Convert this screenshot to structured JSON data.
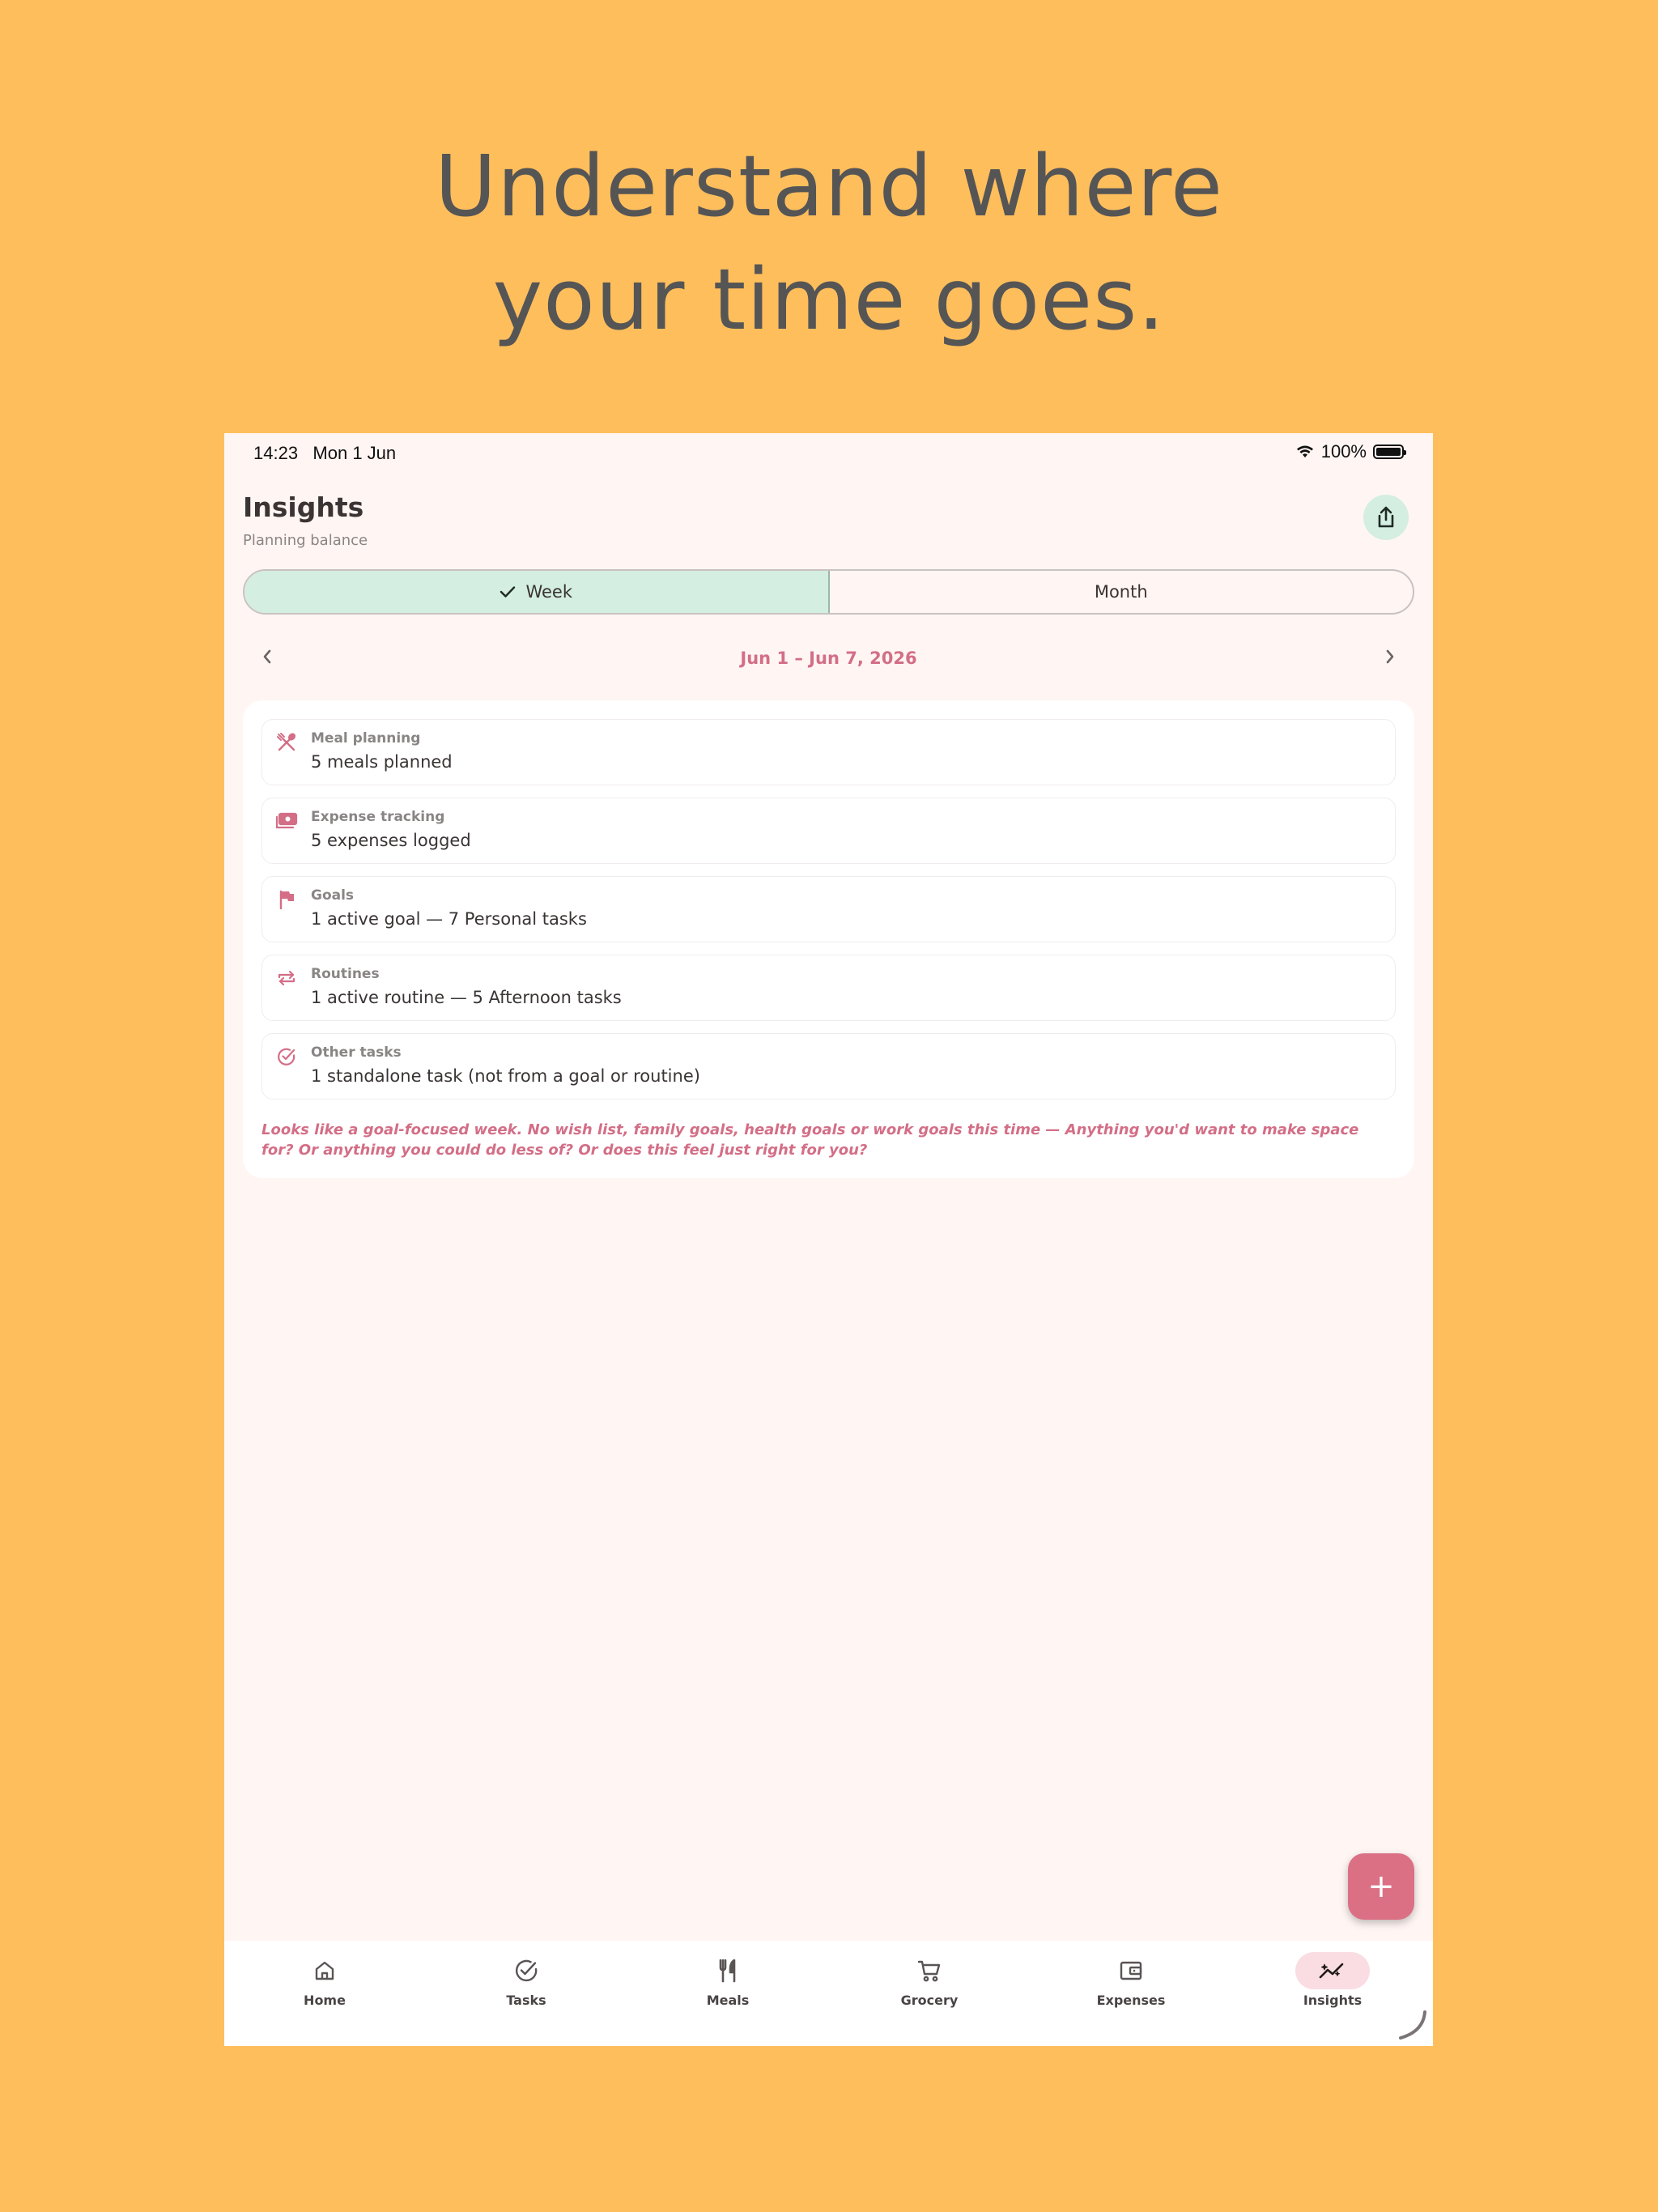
{
  "headline": {
    "line1": "Understand where",
    "line2": "your time goes."
  },
  "status_bar": {
    "time": "14:23",
    "date": "Mon 1 Jun",
    "battery": "100%",
    "battery_level": 1.0
  },
  "header": {
    "title": "Insights",
    "subtitle": "Planning balance",
    "share_icon": "share-icon"
  },
  "segmented": {
    "week_label": "Week",
    "month_label": "Month",
    "selected": "Week"
  },
  "date_range": {
    "label": "Jun 1 – Jun 7, 2026"
  },
  "items": [
    {
      "label": "Meal planning",
      "value": "5 meals planned",
      "icon": "utensils-icon"
    },
    {
      "label": "Expense tracking",
      "value": "5 expenses logged",
      "icon": "money-icon"
    },
    {
      "label": "Goals",
      "value": "1 active goal — 7 Personal tasks",
      "icon": "flag-icon"
    },
    {
      "label": "Routines",
      "value": "1 active routine — 5 Afternoon tasks",
      "icon": "repeat-icon"
    },
    {
      "label": "Other tasks",
      "value": "1 standalone task (not from a goal or routine)",
      "icon": "check-circle-icon"
    }
  ],
  "note": "Looks like a goal-focused week. No wish list, family goals, health goals or work goals this time — Anything you'd want to make space for? Or anything you could do less of? Or does this feel just right for you?",
  "fab": {
    "label": "+"
  },
  "nav": [
    {
      "label": "Home",
      "icon": "home-icon"
    },
    {
      "label": "Tasks",
      "icon": "check-circle-icon"
    },
    {
      "label": "Meals",
      "icon": "fork-knife-icon"
    },
    {
      "label": "Grocery",
      "icon": "cart-icon"
    },
    {
      "label": "Expenses",
      "icon": "wallet-icon"
    },
    {
      "label": "Insights",
      "icon": "insights-chart-icon",
      "active": true
    }
  ],
  "colors": {
    "background": "#FFBE5C",
    "accent": "#D36E86",
    "mint": "#D4EEE1",
    "fab": "#DB7085"
  }
}
